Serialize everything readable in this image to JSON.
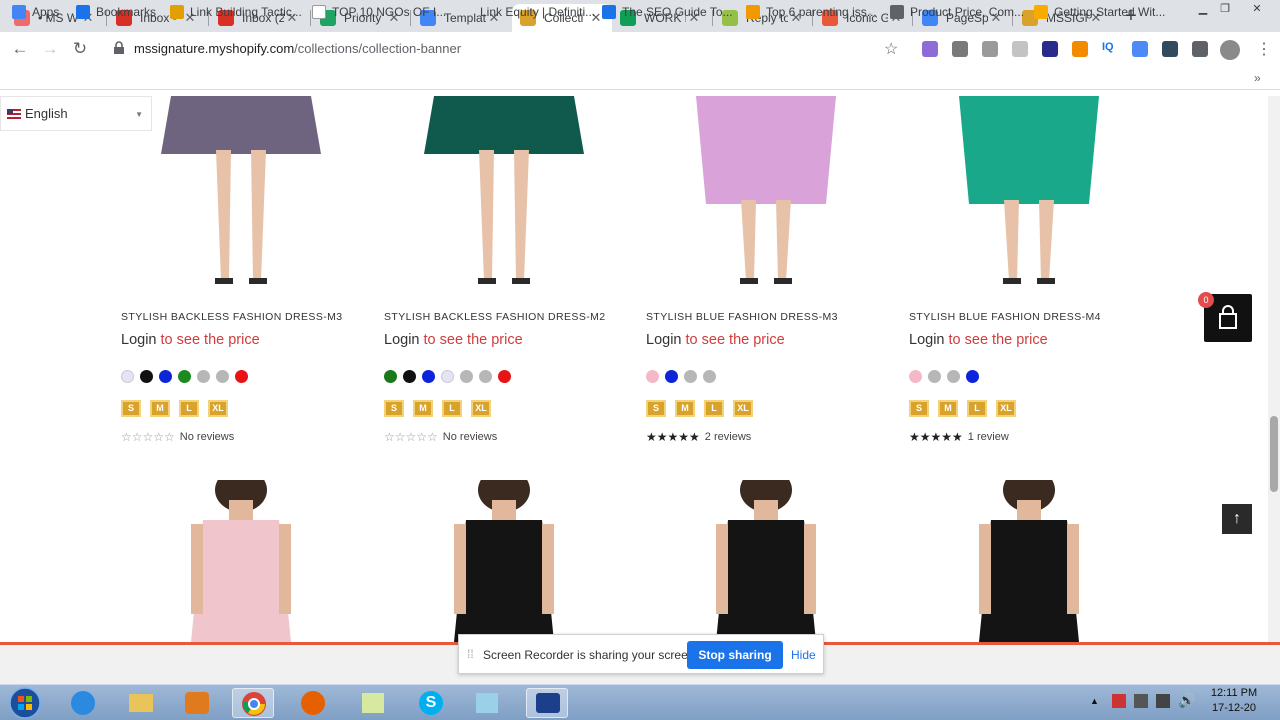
{
  "browser": {
    "tabs": [
      {
        "label": "• MS W",
        "favicon": "asana-icon",
        "color": "#f06a6a"
      },
      {
        "label": "Inbox -",
        "favicon": "gmail-icon",
        "color": "#d93025"
      },
      {
        "label": "Inbox (2",
        "favicon": "gmail-icon",
        "color": "#d93025"
      },
      {
        "label": "Priority",
        "favicon": "drive-icon",
        "color": "#1fa463"
      },
      {
        "label": "Templat",
        "favicon": "docs-icon",
        "color": "#4285f4"
      },
      {
        "label": "Collecti",
        "favicon": "ms-icon",
        "color": "#d9a32b"
      },
      {
        "label": "WORK F",
        "favicon": "sheets-icon",
        "color": "#0f9d58"
      },
      {
        "label": "Reply to",
        "favicon": "shopify-icon",
        "color": "#95bf47"
      },
      {
        "label": "Iconic G",
        "favicon": "fire-icon",
        "color": "#e8583c"
      },
      {
        "label": "PageSp",
        "favicon": "pagespeed-icon",
        "color": "#4285f4"
      },
      {
        "label": "MSSIGN",
        "favicon": "ms-icon",
        "color": "#d9a32b"
      }
    ],
    "active_tab": 5,
    "url_host": "mssignature.myshopify.com",
    "url_path": "/collections/collection-banner",
    "bookmarks": [
      {
        "label": "Apps",
        "icon": "apps-grid-icon",
        "color": "#4285f4"
      },
      {
        "label": "Bookmarks",
        "icon": "star-icon",
        "color": "#1a73e8"
      },
      {
        "label": "Link Building Tactic...",
        "icon": "compass-icon",
        "color": "#e0a100"
      },
      {
        "label": "TOP 10 NGOs OF I...",
        "icon": "y-icon",
        "color": "#ffffff"
      },
      {
        "label": "Link Equity | Definiti...",
        "icon": "",
        "color": ""
      },
      {
        "label": "The SEO Guide To...",
        "icon": "sej-icon",
        "color": "#1a73e8"
      },
      {
        "label": "Top 6 parenting iss...",
        "icon": "flower-icon",
        "color": "#f29900"
      },
      {
        "label": "Product Price, Com...",
        "icon": "globe-icon",
        "color": "#5f6368"
      },
      {
        "label": "Getting Started Wit...",
        "icon": "search-icon",
        "color": "#f9ab00"
      }
    ]
  },
  "page": {
    "language": "English",
    "products": [
      {
        "title": "STYLISH BACKLESS FASHION DRESS-M3",
        "login": "Login",
        "see_price": "to see the price",
        "swatches": [
          "#e4e4f4",
          "#111111",
          "#0c25d8",
          "#1d8a1d",
          "#b7b7b7",
          "#b7b7b7",
          "#e81414"
        ],
        "sizes": [
          "S",
          "M",
          "L",
          "XL"
        ],
        "stars": "☆☆☆☆☆",
        "rating": 0,
        "reviews": "No reviews",
        "dress_color": "#6f6480"
      },
      {
        "title": "STYLISH BACKLESS FASHION DRESS-M2",
        "login": "Login",
        "see_price": "to see the price",
        "swatches": [
          "#1a7a1a",
          "#111111",
          "#0c25d8",
          "#e4e4f4",
          "#b7b7b7",
          "#b7b7b7",
          "#e81414"
        ],
        "sizes": [
          "S",
          "M",
          "L",
          "XL"
        ],
        "stars": "☆☆☆☆☆",
        "rating": 0,
        "reviews": "No reviews",
        "dress_color": "#0f5a4c"
      },
      {
        "title": "STYLISH BLUE FASHION DRESS-M3",
        "login": "Login",
        "see_price": "to see the price",
        "swatches": [
          "#f4b8c8",
          "#0c25d8",
          "#b7b7b7",
          "#b7b7b7"
        ],
        "sizes": [
          "S",
          "M",
          "L",
          "XL"
        ],
        "stars": "★★★★★",
        "rating": 5,
        "reviews": "2 reviews",
        "dress_color": "#d9a3d9"
      },
      {
        "title": "STYLISH BLUE FASHION DRESS-M4",
        "login": "Login",
        "see_price": "to see the price",
        "swatches": [
          "#f4b8c8",
          "#b7b7b7",
          "#b7b7b7",
          "#0c25d8"
        ],
        "sizes": [
          "S",
          "M",
          "L",
          "XL"
        ],
        "stars": "★★★★★",
        "rating": 5,
        "reviews": "1 review",
        "dress_color": "#1aa88a"
      }
    ],
    "row2_dress_colors": [
      "#f0c6cc",
      "#141414",
      "#141414",
      "#141414"
    ],
    "cart_count": "0",
    "back_to_top": "↑"
  },
  "share_bar": {
    "message": "Screen Recorder is sharing your screen.",
    "stop_label": "Stop sharing",
    "hide_label": "Hide"
  },
  "taskbar": {
    "time": "12:11 PM",
    "date": "17-12-20"
  }
}
